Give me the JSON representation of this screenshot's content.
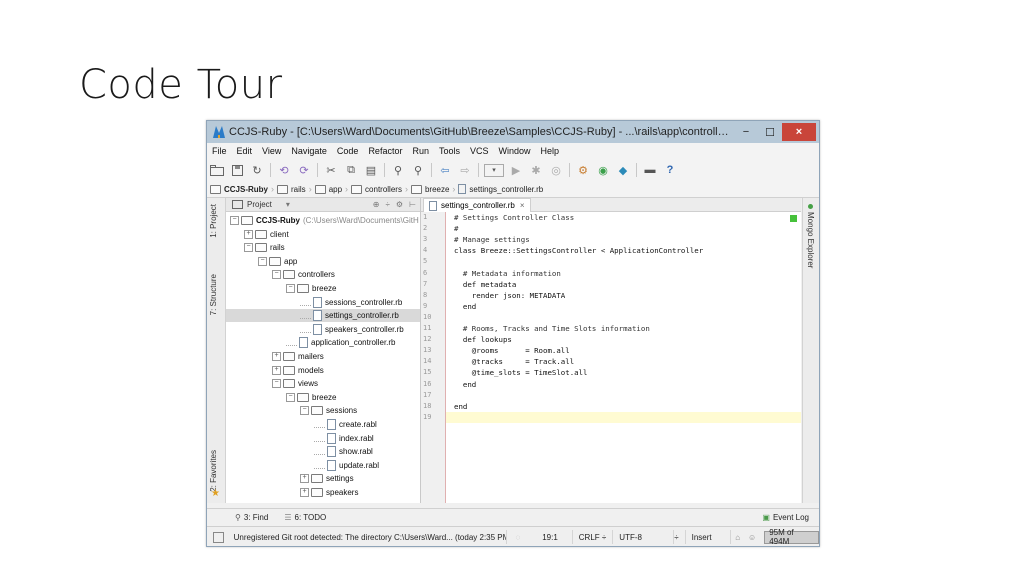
{
  "slide": {
    "title": "Code Tour"
  },
  "window": {
    "title": "CCJS-Ruby - [C:\\Users\\Ward\\Documents\\GitHub\\Breeze\\Samples\\CCJS-Ruby] - ...\\rails\\app\\controllers\\breeze\\set...",
    "minimize": "−",
    "maximize": "☐",
    "close": "×"
  },
  "menu": [
    "File",
    "Edit",
    "View",
    "Navigate",
    "Code",
    "Refactor",
    "Run",
    "Tools",
    "VCS",
    "Window",
    "Help"
  ],
  "breadcrumb": [
    "CCJS-Ruby",
    "rails",
    "app",
    "controllers",
    "breeze",
    "settings_controller.rb"
  ],
  "left_strip": {
    "project": "1: Project",
    "structure": "7: Structure",
    "favorites": "2: Favorites"
  },
  "project_panel": {
    "header": "Project",
    "tree": [
      {
        "label": "CCJS-Ruby",
        "hint": "(C:\\Users\\Ward\\Documents\\GitH",
        "type": "folder",
        "depth": 0,
        "bold": true
      },
      {
        "label": "client",
        "type": "folder",
        "depth": 1
      },
      {
        "label": "rails",
        "type": "folder",
        "depth": 1
      },
      {
        "label": "app",
        "type": "folder",
        "depth": 2
      },
      {
        "label": "controllers",
        "type": "folder",
        "depth": 3
      },
      {
        "label": "breeze",
        "type": "folder",
        "depth": 4
      },
      {
        "label": "sessions_controller.rb",
        "type": "file",
        "depth": 5
      },
      {
        "label": "settings_controller.rb",
        "type": "file",
        "depth": 5,
        "selected": true
      },
      {
        "label": "speakers_controller.rb",
        "type": "file",
        "depth": 5
      },
      {
        "label": "application_controller.rb",
        "type": "file",
        "depth": 4
      },
      {
        "label": "mailers",
        "type": "folder",
        "depth": 3
      },
      {
        "label": "models",
        "type": "folder",
        "depth": 3
      },
      {
        "label": "views",
        "type": "folder",
        "depth": 3
      },
      {
        "label": "breeze",
        "type": "folder",
        "depth": 4
      },
      {
        "label": "sessions",
        "type": "folder",
        "depth": 5
      },
      {
        "label": "create.rabl",
        "type": "file",
        "depth": 6
      },
      {
        "label": "index.rabl",
        "type": "file",
        "depth": 6
      },
      {
        "label": "show.rabl",
        "type": "file",
        "depth": 6
      },
      {
        "label": "update.rabl",
        "type": "file",
        "depth": 6
      },
      {
        "label": "settings",
        "type": "folder",
        "depth": 5
      },
      {
        "label": "speakers",
        "type": "folder",
        "depth": 5
      }
    ]
  },
  "editor": {
    "tab_label": "settings_controller.rb",
    "tab_close": "×",
    "lines": [
      "# Settings Controller Class",
      "#",
      "# Manage settings",
      "class Breeze::SettingsController < ApplicationController",
      "",
      "  # Metadata information",
      "  def metadata",
      "    render json: METADATA",
      "  end",
      "",
      "  # Rooms, Tracks and Time Slots information",
      "  def lookups",
      "    @rooms      = Room.all",
      "    @tracks     = Track.all",
      "    @time_slots = TimeSlot.all",
      "  end",
      "",
      "end",
      ""
    ]
  },
  "right_strip": {
    "label": "Mongo Explorer"
  },
  "bottom_tools": {
    "find": "3: Find",
    "todo": "6: TODO",
    "event_log": "Event Log"
  },
  "status": {
    "message": "Unregistered Git root detected: The directory C:\\Users\\Ward... (today 2:35 PM)",
    "position": "19:1",
    "line_sep": "CRLF ÷",
    "encoding": "UTF-8",
    "encoding_arrow": "÷",
    "mode": "Insert",
    "memory": "95M of 494M"
  },
  "colors": {
    "titlebar": "#b7c9d8",
    "close": "#c9453a",
    "current_line": "#fffbd2",
    "selection": "#d9d9d9"
  }
}
